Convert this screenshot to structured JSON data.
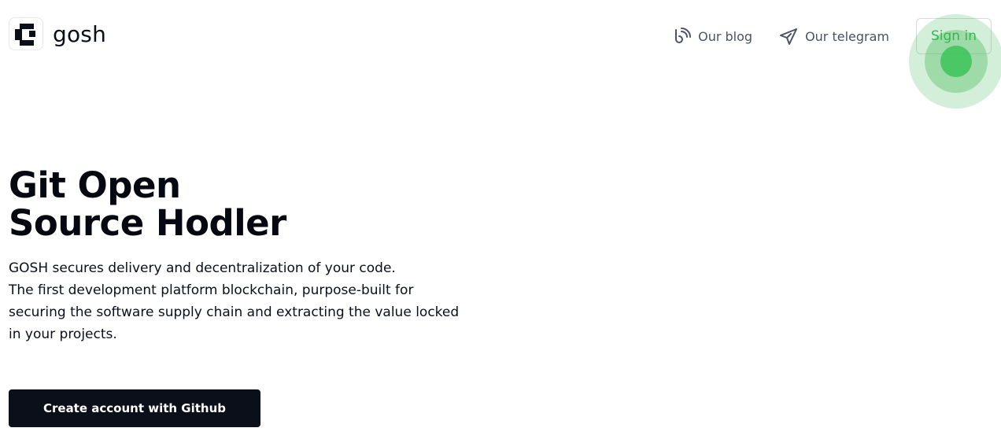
{
  "header": {
    "logo_text": "gosh",
    "nav": {
      "blog_label": "Our blog",
      "telegram_label": "Our telegram",
      "signin_label": "Sign in"
    },
    "icons": {
      "logo": "gosh-logo-icon",
      "blog": "blog-icon",
      "telegram": "paper-plane-icon"
    }
  },
  "hero": {
    "title_line1": "Git Open",
    "title_line2": "Source Hodler",
    "description_lines": [
      "GOSH secures delivery and decentralization of your code.",
      "The first development platform blockchain, purpose-built for",
      "securing the software supply chain and extracting the value locked",
      "in your projects."
    ],
    "cta_label": "Create account with Github"
  },
  "colors": {
    "accent_green": "#2fba55",
    "primary_dark": "#0b0f19",
    "nav_text": "#4a5263"
  }
}
